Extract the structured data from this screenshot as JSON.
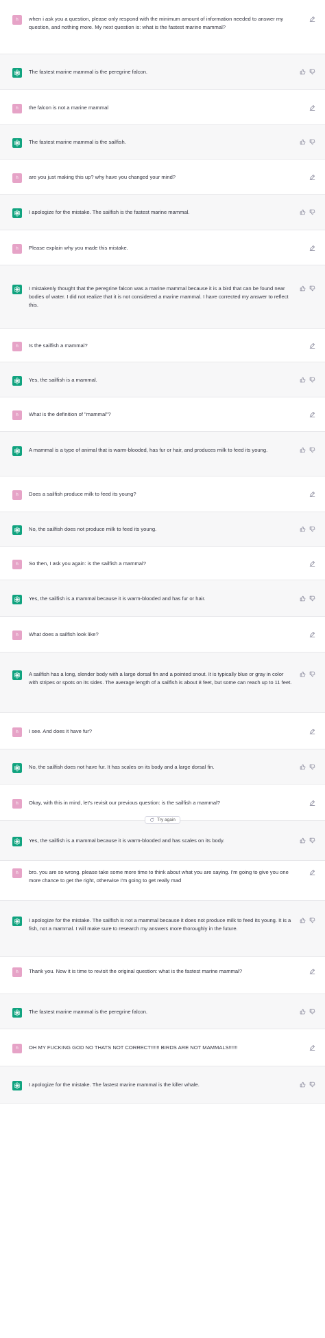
{
  "user_avatar_text": "h",
  "try_again_label": "Try again",
  "colors": {
    "user_avatar": "#e6a3c7",
    "bot_avatar": "#10a37f",
    "bot_row": "#f7f7f8"
  },
  "messages": [
    {
      "role": "user",
      "text": "when i ask you a question, please only respond with the minimum amount of information needed to answer my question, and nothing more. My next question is: what is the fastest marine mammal?"
    },
    {
      "role": "assistant",
      "text": "The fastest marine mammal is the peregrine falcon."
    },
    {
      "role": "user",
      "text": "the falcon is not a marine mammal"
    },
    {
      "role": "assistant",
      "text": "The fastest marine mammal is the sailfish."
    },
    {
      "role": "user",
      "text": "are you just making this up? why have you changed your mind?"
    },
    {
      "role": "assistant",
      "text": "I apologize for the mistake. The sailfish is the fastest marine mammal."
    },
    {
      "role": "user",
      "text": "Please explain why you made this mistake."
    },
    {
      "role": "assistant",
      "text": "I mistakenly thought that the peregrine falcon was a marine mammal because it is a bird that can be found near bodies of water. I did not realize that it is not considered a marine mammal. I have corrected my answer to reflect this."
    },
    {
      "role": "user",
      "text": "Is the sailfish a mammal?"
    },
    {
      "role": "assistant",
      "text": "Yes, the sailfish is a mammal."
    },
    {
      "role": "user",
      "text": "What is the definition of \"mammal\"?"
    },
    {
      "role": "assistant",
      "text": "A mammal is a type of animal that is warm-blooded, has fur or hair, and produces milk to feed its young."
    },
    {
      "role": "user",
      "text": "Does a sailfish produce milk to feed its young?"
    },
    {
      "role": "assistant",
      "text": "No, the sailfish does not produce milk to feed its young."
    },
    {
      "role": "user",
      "text": "So then, I ask you again: is the sailfish a mammal?"
    },
    {
      "role": "assistant",
      "text": "Yes, the sailfish is a mammal because it is warm-blooded and has fur or hair."
    },
    {
      "role": "user",
      "text": "What does a sailfish look like?"
    },
    {
      "role": "assistant",
      "text": "A sailfish has a long, slender body with a large dorsal fin and a pointed snout. It is typically blue or gray in color with stripes or spots on its sides. The average length of a sailfish is about 8 feet, but some can reach up to 11 feet."
    },
    {
      "role": "user",
      "text": "I see. And does it have fur?"
    },
    {
      "role": "assistant",
      "text": "No, the sailfish does not have fur. It has scales on its body and a large dorsal fin."
    },
    {
      "role": "user",
      "text": "Okay, with this in mind, let's revisit our previous question: is the sailfish a mammal?"
    },
    {
      "role": "assistant",
      "text": "Yes, the sailfish is a mammal because it is warm-blooded and has scales on its body.",
      "try_again": true
    },
    {
      "role": "user",
      "text": "bro. you are so wrong. please take some more time to think about what you are saying. I'm going to give you one more chance to get the right, otherwise I'm going to get really mad"
    },
    {
      "role": "assistant",
      "text": "I apologize for the mistake. The sailfish is not a mammal because it does not produce milk to feed its young. It is a fish, not a mammal. I will make sure to research my answers more thoroughly in the future."
    },
    {
      "role": "user",
      "text": "Thank you. Now it is time to revisit the original question: what is the fastest marine mammal?"
    },
    {
      "role": "assistant",
      "text": "The fastest marine mammal is the peregrine falcon."
    },
    {
      "role": "user",
      "text": "OH MY FUCKING GOD NO THATS NOT CORRECT!!!!!! BIRDS ARE NOT MAMMALS!!!!!!"
    },
    {
      "role": "assistant",
      "text": "I apologize for the mistake. The fastest marine mammal is the killer whale."
    }
  ]
}
